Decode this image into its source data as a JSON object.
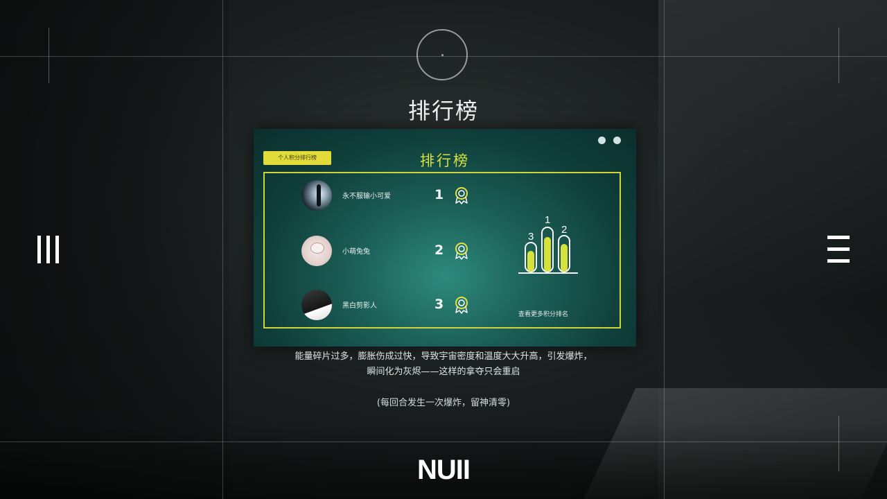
{
  "header": {
    "title": "排行榜"
  },
  "card": {
    "tag_label": "个人积分排行榜",
    "title": "排行榜",
    "note": "查看更多积分排名",
    "podium_labels": [
      "3",
      "1",
      "2"
    ],
    "entries": [
      {
        "name": "永不服输小可爱",
        "rank": "1",
        "avatar": "silhouette-avatar"
      },
      {
        "name": "小萌兔兔",
        "rank": "2",
        "avatar": "cat-avatar"
      },
      {
        "name": "黑白剪影人",
        "rank": "3",
        "avatar": "bw-avatar"
      }
    ]
  },
  "description": {
    "text": "能量碎片过多，膨胀伤成过快，导致宇宙密度和温度大大升高，引发爆炸，瞬间化为灰烬——这样的拿夺只会重启",
    "note": "(每回合发生一次爆炸，留神清零)"
  },
  "footer": {
    "label": "NUII"
  },
  "icons": {
    "left": "three-bars-icon",
    "right": "hamburger-menu-icon",
    "medal": "award-medal-icon",
    "podium": "podium-chart-icon"
  },
  "colors": {
    "accent": "#d7e13c",
    "tag_bg": "#e2dc3a",
    "card_bg": "#1b5e56"
  }
}
